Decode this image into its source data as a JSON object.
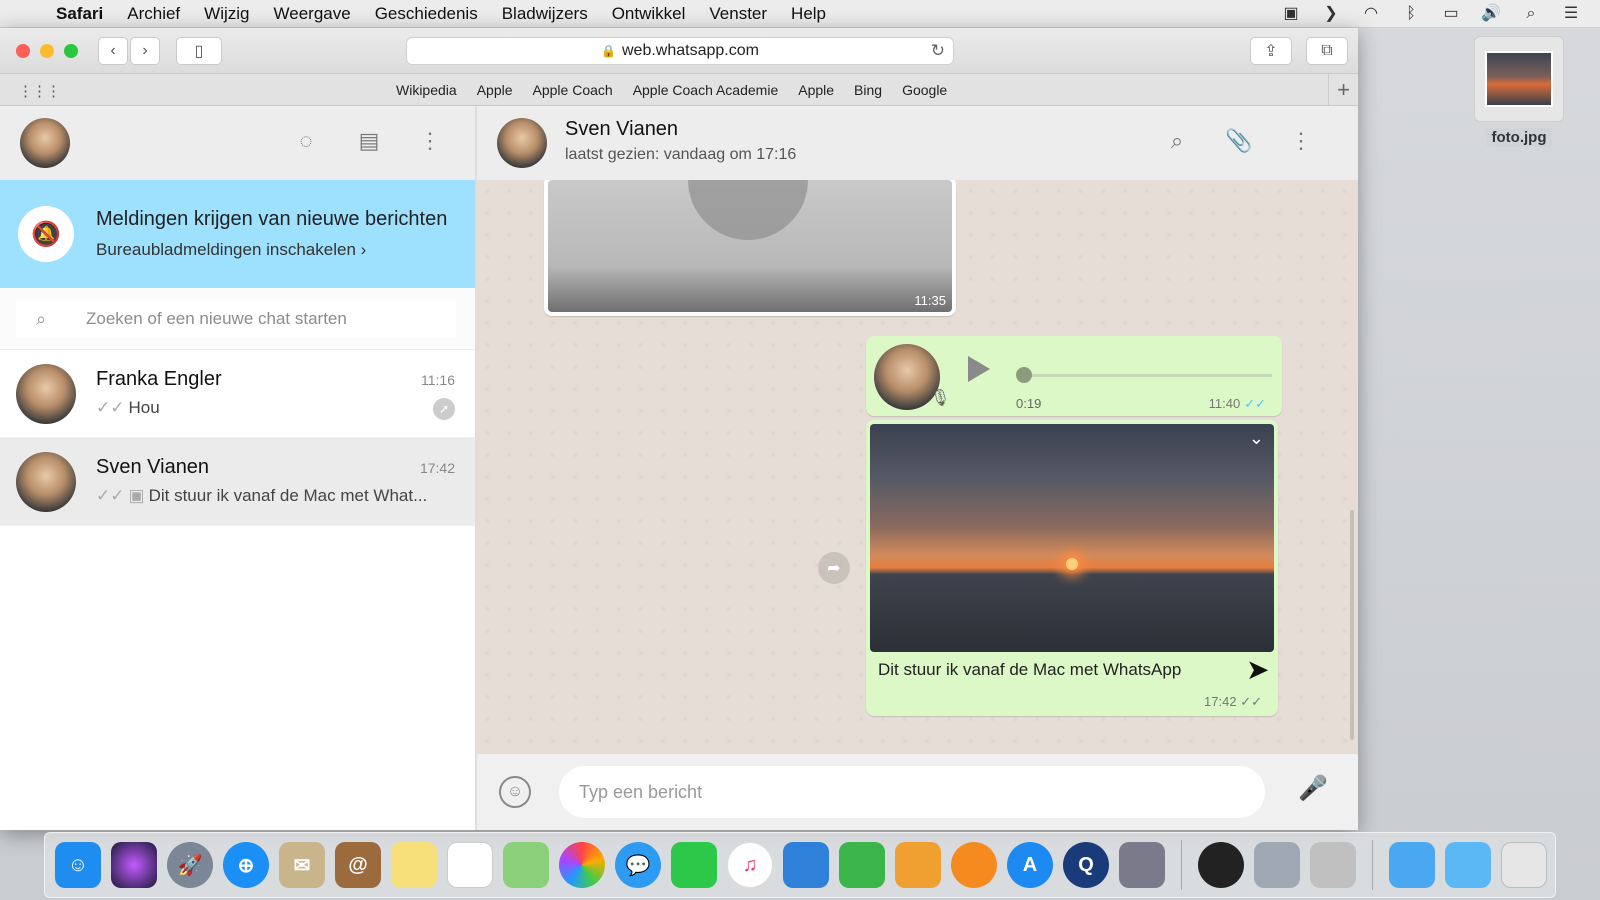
{
  "menubar": {
    "items": [
      "Safari",
      "Archief",
      "Wijzig",
      "Weergave",
      "Geschiedenis",
      "Bladwijzers",
      "Ontwikkel",
      "Venster",
      "Help"
    ]
  },
  "desktop_file": {
    "label": "foto.jpg"
  },
  "browser": {
    "url": "web.whatsapp.com",
    "favorites": [
      "Wikipedia",
      "Apple",
      "Apple Coach",
      "Apple Coach Academie",
      "Apple",
      "Bing",
      "Google"
    ]
  },
  "sidebar": {
    "notification": {
      "title": "Meldingen krijgen van nieuwe berichten",
      "link": "Bureaubladmeldingen inschakelen ›"
    },
    "search_placeholder": "Zoeken of een nieuwe chat starten",
    "chats": [
      {
        "name": "Franka Engler",
        "time": "11:16",
        "preview": "Hou"
      },
      {
        "name": "Sven Vianen",
        "time": "17:42",
        "preview": "Dit stuur ik vanaf de Mac met What..."
      }
    ]
  },
  "conversation": {
    "contact_name": "Sven Vianen",
    "status": "laatst gezien: vandaag om 17:16",
    "image_time": "11:35",
    "voice": {
      "duration": "0:19",
      "time": "11:40",
      "progress": 0
    },
    "photo": {
      "caption": "Dit stuur ik vanaf de Mac met WhatsApp",
      "time": "17:42"
    },
    "composer_placeholder": "Typ een bericht"
  },
  "colors": {
    "notification_bg": "#9de1fe",
    "outgoing_bubble": "#dcf8c6",
    "chat_bg": "#e6ded6"
  }
}
